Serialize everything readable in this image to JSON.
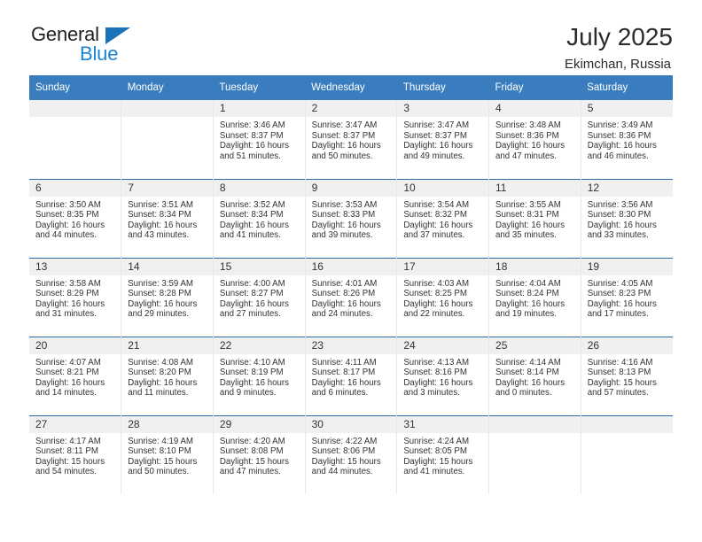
{
  "brand": {
    "name_top": "General",
    "name_bottom": "Blue",
    "triangle_color": "#1b72b8",
    "blue_text_color": "#1b83d4"
  },
  "header": {
    "title": "July 2025",
    "subtitle": "Ekimchan, Russia"
  },
  "theme": {
    "header_row_bg": "#3a7dbf",
    "week_divider": "#2e6da4",
    "daynum_bg": "#f0f0f0",
    "column_divider": "#e9e9e9"
  },
  "weekday_headers": [
    "Sunday",
    "Monday",
    "Tuesday",
    "Wednesday",
    "Thursday",
    "Friday",
    "Saturday"
  ],
  "labels": {
    "sunrise_prefix": "Sunrise:",
    "sunset_prefix": "Sunset:",
    "daylight_prefix": "Daylight:"
  },
  "weeks": [
    [
      {
        "day": "",
        "line1": "",
        "line2": "",
        "line3": "",
        "line4": ""
      },
      {
        "day": "",
        "line1": "",
        "line2": "",
        "line3": "",
        "line4": ""
      },
      {
        "day": "1",
        "line1": "Sunrise: 3:46 AM",
        "line2": "Sunset: 8:37 PM",
        "line3": "Daylight: 16 hours",
        "line4": "and 51 minutes."
      },
      {
        "day": "2",
        "line1": "Sunrise: 3:47 AM",
        "line2": "Sunset: 8:37 PM",
        "line3": "Daylight: 16 hours",
        "line4": "and 50 minutes."
      },
      {
        "day": "3",
        "line1": "Sunrise: 3:47 AM",
        "line2": "Sunset: 8:37 PM",
        "line3": "Daylight: 16 hours",
        "line4": "and 49 minutes."
      },
      {
        "day": "4",
        "line1": "Sunrise: 3:48 AM",
        "line2": "Sunset: 8:36 PM",
        "line3": "Daylight: 16 hours",
        "line4": "and 47 minutes."
      },
      {
        "day": "5",
        "line1": "Sunrise: 3:49 AM",
        "line2": "Sunset: 8:36 PM",
        "line3": "Daylight: 16 hours",
        "line4": "and 46 minutes."
      }
    ],
    [
      {
        "day": "6",
        "line1": "Sunrise: 3:50 AM",
        "line2": "Sunset: 8:35 PM",
        "line3": "Daylight: 16 hours",
        "line4": "and 44 minutes."
      },
      {
        "day": "7",
        "line1": "Sunrise: 3:51 AM",
        "line2": "Sunset: 8:34 PM",
        "line3": "Daylight: 16 hours",
        "line4": "and 43 minutes."
      },
      {
        "day": "8",
        "line1": "Sunrise: 3:52 AM",
        "line2": "Sunset: 8:34 PM",
        "line3": "Daylight: 16 hours",
        "line4": "and 41 minutes."
      },
      {
        "day": "9",
        "line1": "Sunrise: 3:53 AM",
        "line2": "Sunset: 8:33 PM",
        "line3": "Daylight: 16 hours",
        "line4": "and 39 minutes."
      },
      {
        "day": "10",
        "line1": "Sunrise: 3:54 AM",
        "line2": "Sunset: 8:32 PM",
        "line3": "Daylight: 16 hours",
        "line4": "and 37 minutes."
      },
      {
        "day": "11",
        "line1": "Sunrise: 3:55 AM",
        "line2": "Sunset: 8:31 PM",
        "line3": "Daylight: 16 hours",
        "line4": "and 35 minutes."
      },
      {
        "day": "12",
        "line1": "Sunrise: 3:56 AM",
        "line2": "Sunset: 8:30 PM",
        "line3": "Daylight: 16 hours",
        "line4": "and 33 minutes."
      }
    ],
    [
      {
        "day": "13",
        "line1": "Sunrise: 3:58 AM",
        "line2": "Sunset: 8:29 PM",
        "line3": "Daylight: 16 hours",
        "line4": "and 31 minutes."
      },
      {
        "day": "14",
        "line1": "Sunrise: 3:59 AM",
        "line2": "Sunset: 8:28 PM",
        "line3": "Daylight: 16 hours",
        "line4": "and 29 minutes."
      },
      {
        "day": "15",
        "line1": "Sunrise: 4:00 AM",
        "line2": "Sunset: 8:27 PM",
        "line3": "Daylight: 16 hours",
        "line4": "and 27 minutes."
      },
      {
        "day": "16",
        "line1": "Sunrise: 4:01 AM",
        "line2": "Sunset: 8:26 PM",
        "line3": "Daylight: 16 hours",
        "line4": "and 24 minutes."
      },
      {
        "day": "17",
        "line1": "Sunrise: 4:03 AM",
        "line2": "Sunset: 8:25 PM",
        "line3": "Daylight: 16 hours",
        "line4": "and 22 minutes."
      },
      {
        "day": "18",
        "line1": "Sunrise: 4:04 AM",
        "line2": "Sunset: 8:24 PM",
        "line3": "Daylight: 16 hours",
        "line4": "and 19 minutes."
      },
      {
        "day": "19",
        "line1": "Sunrise: 4:05 AM",
        "line2": "Sunset: 8:23 PM",
        "line3": "Daylight: 16 hours",
        "line4": "and 17 minutes."
      }
    ],
    [
      {
        "day": "20",
        "line1": "Sunrise: 4:07 AM",
        "line2": "Sunset: 8:21 PM",
        "line3": "Daylight: 16 hours",
        "line4": "and 14 minutes."
      },
      {
        "day": "21",
        "line1": "Sunrise: 4:08 AM",
        "line2": "Sunset: 8:20 PM",
        "line3": "Daylight: 16 hours",
        "line4": "and 11 minutes."
      },
      {
        "day": "22",
        "line1": "Sunrise: 4:10 AM",
        "line2": "Sunset: 8:19 PM",
        "line3": "Daylight: 16 hours",
        "line4": "and 9 minutes."
      },
      {
        "day": "23",
        "line1": "Sunrise: 4:11 AM",
        "line2": "Sunset: 8:17 PM",
        "line3": "Daylight: 16 hours",
        "line4": "and 6 minutes."
      },
      {
        "day": "24",
        "line1": "Sunrise: 4:13 AM",
        "line2": "Sunset: 8:16 PM",
        "line3": "Daylight: 16 hours",
        "line4": "and 3 minutes."
      },
      {
        "day": "25",
        "line1": "Sunrise: 4:14 AM",
        "line2": "Sunset: 8:14 PM",
        "line3": "Daylight: 16 hours",
        "line4": "and 0 minutes."
      },
      {
        "day": "26",
        "line1": "Sunrise: 4:16 AM",
        "line2": "Sunset: 8:13 PM",
        "line3": "Daylight: 15 hours",
        "line4": "and 57 minutes."
      }
    ],
    [
      {
        "day": "27",
        "line1": "Sunrise: 4:17 AM",
        "line2": "Sunset: 8:11 PM",
        "line3": "Daylight: 15 hours",
        "line4": "and 54 minutes."
      },
      {
        "day": "28",
        "line1": "Sunrise: 4:19 AM",
        "line2": "Sunset: 8:10 PM",
        "line3": "Daylight: 15 hours",
        "line4": "and 50 minutes."
      },
      {
        "day": "29",
        "line1": "Sunrise: 4:20 AM",
        "line2": "Sunset: 8:08 PM",
        "line3": "Daylight: 15 hours",
        "line4": "and 47 minutes."
      },
      {
        "day": "30",
        "line1": "Sunrise: 4:22 AM",
        "line2": "Sunset: 8:06 PM",
        "line3": "Daylight: 15 hours",
        "line4": "and 44 minutes."
      },
      {
        "day": "31",
        "line1": "Sunrise: 4:24 AM",
        "line2": "Sunset: 8:05 PM",
        "line3": "Daylight: 15 hours",
        "line4": "and 41 minutes."
      },
      {
        "day": "",
        "line1": "",
        "line2": "",
        "line3": "",
        "line4": ""
      },
      {
        "day": "",
        "line1": "",
        "line2": "",
        "line3": "",
        "line4": ""
      }
    ]
  ]
}
